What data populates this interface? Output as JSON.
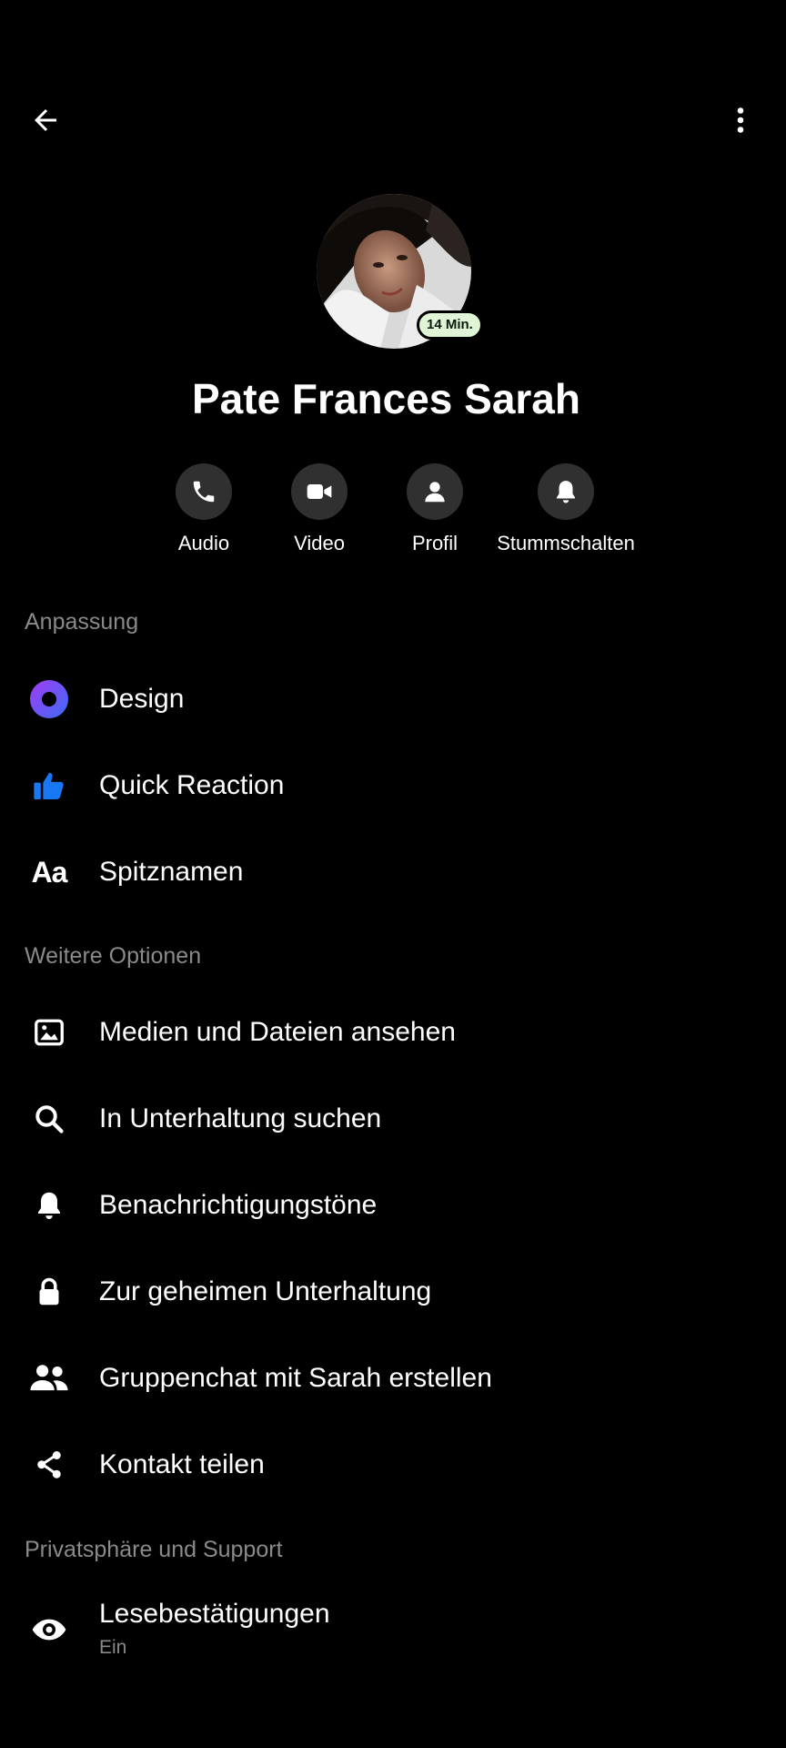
{
  "header": {
    "badge": "14 Min."
  },
  "contact": {
    "name": "Pate Frances Sarah"
  },
  "actions": [
    {
      "label": "Audio",
      "icon": "phone-icon"
    },
    {
      "label": "Video",
      "icon": "video-camera-icon"
    },
    {
      "label": "Profil",
      "icon": "person-icon"
    },
    {
      "label": "Stummschalten",
      "icon": "bell-icon"
    }
  ],
  "sections": {
    "customization": {
      "title": "Anpassung",
      "items": [
        {
          "label": "Design",
          "icon": "theme-circle-icon"
        },
        {
          "label": "Quick Reaction",
          "icon": "thumbs-up-icon"
        },
        {
          "label": "Spitznamen",
          "icon": "nickname-aa-icon",
          "glyph": "Aa"
        }
      ]
    },
    "more": {
      "title": "Weitere Optionen",
      "items": [
        {
          "label": "Medien und Dateien ansehen",
          "icon": "image-icon"
        },
        {
          "label": "In Unterhaltung suchen",
          "icon": "search-icon"
        },
        {
          "label": "Benachrichtigungstöne",
          "icon": "bell-icon"
        },
        {
          "label": "Zur geheimen Unterhaltung",
          "icon": "lock-icon"
        },
        {
          "label": "Gruppenchat mit Sarah erstellen",
          "icon": "group-icon"
        },
        {
          "label": "Kontakt teilen",
          "icon": "share-icon"
        }
      ]
    },
    "privacy": {
      "title": "Privatsphäre und Support",
      "items": [
        {
          "label": "Lesebestätigungen",
          "sublabel": "Ein",
          "icon": "eye-icon"
        }
      ]
    }
  },
  "colors": {
    "background": "#000000",
    "section_header": "#8a8a8a",
    "action_circle": "#303030",
    "accent_blue": "#1877f2",
    "accent_purple": "#7b3cf5",
    "badge_bg": "#dff5d6"
  }
}
